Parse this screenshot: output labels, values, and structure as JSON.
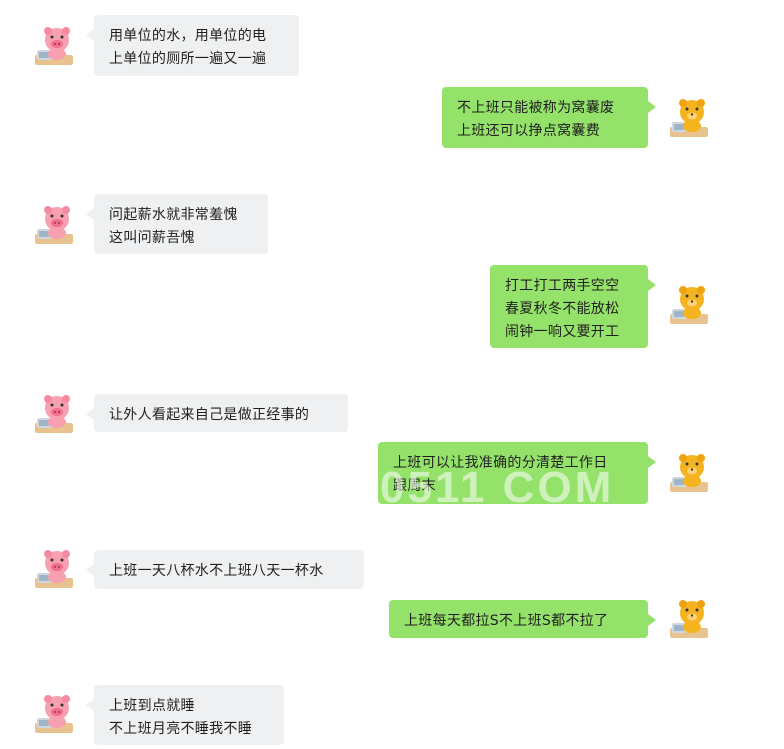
{
  "messages": [
    {
      "side": "left",
      "speaker": "pink-pig",
      "text": "用单位的水，用单位的电\n上单位的厕所一遍又一遍"
    },
    {
      "side": "right",
      "speaker": "yellow-bear",
      "text": "不上班只能被称为窝囊废\n上班还可以挣点窝囊费"
    },
    {
      "side": "left",
      "speaker": "pink-pig",
      "text": "问起薪水就非常羞愧\n这叫问薪吾愧"
    },
    {
      "side": "right",
      "speaker": "yellow-bear",
      "text": "打工打工两手空空\n春夏秋冬不能放松\n闹钟一响又要开工"
    },
    {
      "side": "left",
      "speaker": "pink-pig",
      "text": "让外人看起来自己是做正经事的"
    },
    {
      "side": "right",
      "speaker": "yellow-bear",
      "text": "上班可以让我准确的分清楚工作日\n跟周末"
    },
    {
      "side": "left",
      "speaker": "pink-pig",
      "text": "上班一天八杯水不上班八天一杯水"
    },
    {
      "side": "right",
      "speaker": "yellow-bear",
      "text": "上班每天都拉S不上班S都不拉了"
    },
    {
      "side": "left",
      "speaker": "pink-pig",
      "text": "上班到点就睡\n不上班月亮不睡我不睡"
    }
  ],
  "watermark": "0511 COM",
  "colors": {
    "left_bubble": "#eef0f1",
    "right_bubble": "#95e26a",
    "text": "#1f1f1f"
  },
  "icons": {
    "left_avatar": "pink-pig-avatar-icon",
    "right_avatar": "yellow-bear-avatar-icon"
  }
}
